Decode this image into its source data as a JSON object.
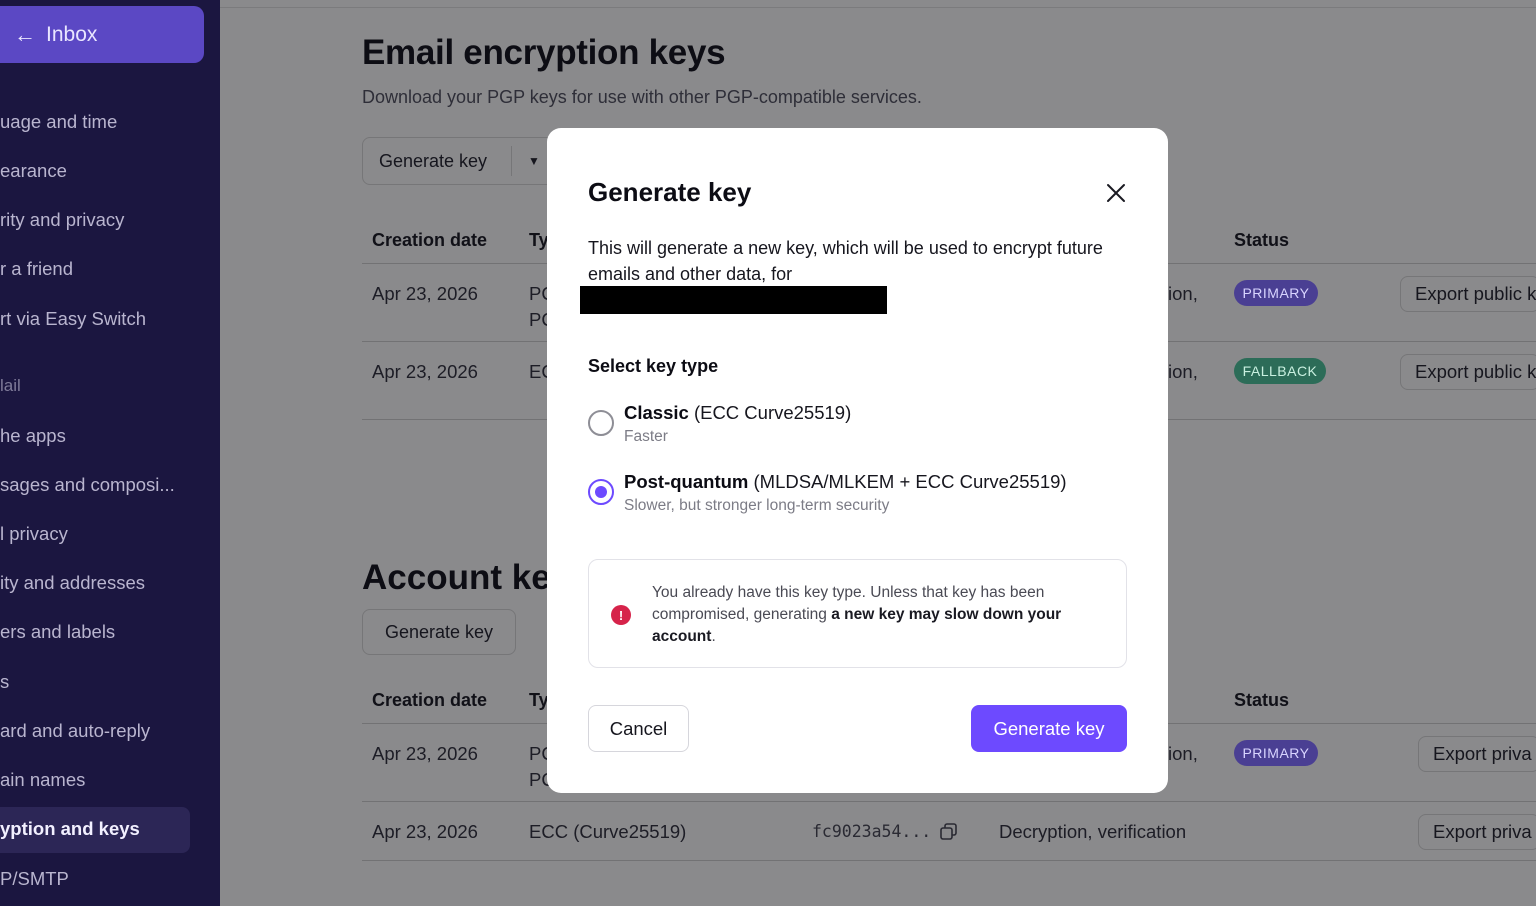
{
  "sidebar": {
    "inbox_label": "Inbox",
    "items": [
      "uage and time",
      "earance",
      "rity and privacy",
      "r a friend",
      "rt via Easy Switch"
    ],
    "section_mail": "lail",
    "mail_items": [
      "he apps",
      "sages and composi...",
      "l privacy",
      "ity and addresses",
      "ers and labels",
      "s",
      "ard and auto-reply",
      "ain names"
    ],
    "active_item": "yption and keys",
    "last_item": "P/SMTP"
  },
  "email_keys": {
    "title": "Email encryption keys",
    "subtitle": "Download your PGP keys for use with other PGP-compatible services.",
    "generate_label": "Generate key",
    "headers": {
      "creation": "Creation date",
      "type": "Ty",
      "status": "Status"
    },
    "rows": [
      {
        "date": "Apr 23, 2026",
        "type1": "PC",
        "type2": "PC",
        "usage": "ion,",
        "status": "PRIMARY",
        "action": "Export public k"
      },
      {
        "date": "Apr 23, 2026",
        "type1": "EC",
        "type2": "",
        "usage": "ion,",
        "status": "FALLBACK",
        "action": "Export public k"
      }
    ]
  },
  "account_keys": {
    "title": "Account ke",
    "generate_label": "Generate key",
    "headers": {
      "creation": "Creation date",
      "type": "Ty",
      "status": "Status"
    },
    "rows": [
      {
        "date": "Apr 23, 2026",
        "type1": "PC",
        "type2": "PC",
        "usage": "ion,",
        "status": "PRIMARY",
        "action": "Export priva"
      },
      {
        "date": "Apr 23, 2026",
        "type1": "ECC (Curve25519)",
        "fingerprint": "fc9023a54...",
        "usage": "Decryption, verification",
        "action": "Export priva"
      }
    ]
  },
  "modal": {
    "title": "Generate key",
    "description": "This will generate a new key, which will be used to encrypt future emails and other data, for",
    "select_label": "Select key type",
    "options": [
      {
        "name": "Classic",
        "detail": "(ECC Curve25519)",
        "sub": "Faster",
        "checked": false
      },
      {
        "name": "Post-quantum",
        "detail": "(MLDSA/MLKEM + ECC Curve25519)",
        "sub": "Slower, but stronger long-term security",
        "checked": true
      }
    ],
    "warning_prefix": "You already have this key type. Unless that key has been compromised, generating ",
    "warning_bold": "a new key may slow down your account",
    "warning_suffix": ".",
    "cancel_label": "Cancel",
    "generate_label": "Generate key"
  },
  "colors": {
    "accent": "#6d4aff",
    "sidebar_bg": "#1b1640",
    "danger": "#d6234a",
    "primary_badge": "#4a3f93",
    "fallback_badge": "#2c6c58"
  }
}
